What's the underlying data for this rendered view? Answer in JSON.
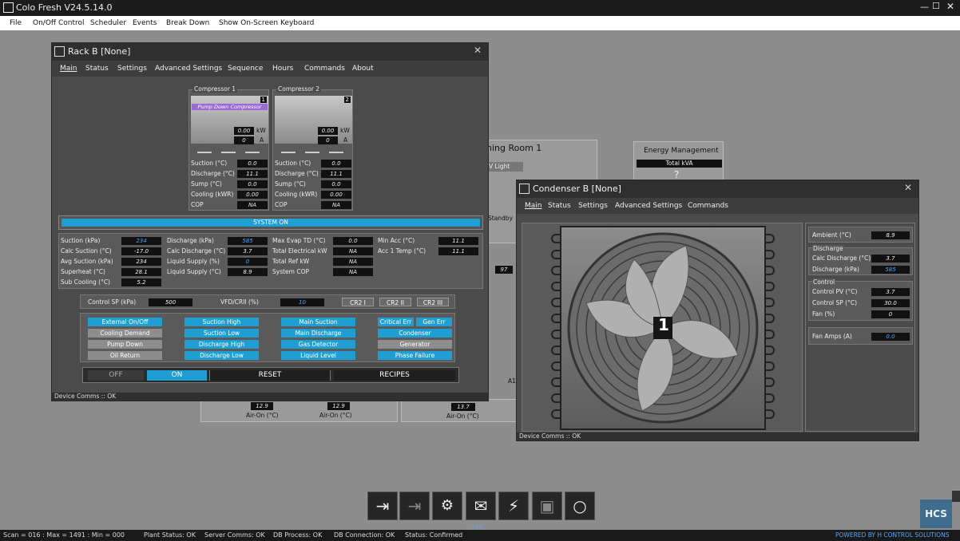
{
  "app": {
    "title": "Colo Fresh V24.5.14.0"
  },
  "menu": [
    "File",
    "On/Off Control",
    "Scheduler",
    "Events",
    "Break Down",
    "Show On-Screen Keyboard"
  ],
  "background": {
    "room_title": "ning Room 1",
    "light_label": "V Light",
    "energy_title": "Energy Management",
    "total_kva": "Total kVA",
    "kva_value": "?",
    "standby": "Standby",
    "airon1_val": "12.9",
    "airon2_val": "12.9",
    "airon3_val": "13.7",
    "airon_label": "Air-On (°C)",
    "bg_val": "97",
    "bg_a": "A1"
  },
  "rack": {
    "title": "Rack B [None]",
    "tabs": [
      "Main",
      "Status",
      "Settings",
      "Advanced Settings",
      "Sequence",
      "Hours",
      "Commands",
      "About"
    ],
    "comp1": {
      "title": "Compressor 1",
      "num": "1",
      "banner": "Pump Down Compressor",
      "kw": "0.00",
      "kw_unit": "kW",
      "amps": "0",
      "amps_unit": "A"
    },
    "comp2": {
      "title": "Compressor 2",
      "num": "2",
      "kw": "0.00",
      "kw_unit": "kW",
      "amps": "0",
      "amps_unit": "A"
    },
    "comp_rows": [
      {
        "label": "Suction (°C)",
        "c1": "0.0",
        "c2": "0.0"
      },
      {
        "label": "Discharge (°C)",
        "c1": "11.1",
        "c2": "11.1"
      },
      {
        "label": "Sump (°C)",
        "c1": "0.0",
        "c2": "0.0"
      },
      {
        "label": "Cooling (kWR)",
        "c1": "0.00",
        "c2": "0.00"
      },
      {
        "label": "COP",
        "c1": "NA",
        "c2": "NA"
      }
    ],
    "system_on": "SYSTEM ON",
    "grid_col1": [
      {
        "label": "Suction (kPa)",
        "value": "234"
      },
      {
        "label": "Calc Suction (°C)",
        "value": "-17.0"
      },
      {
        "label": "Avg Suction (kPa)",
        "value": "234"
      },
      {
        "label": "Superheat (°C)",
        "value": "28.1"
      },
      {
        "label": "Sub Cooling (°C)",
        "value": "5.2"
      }
    ],
    "grid_col2": [
      {
        "label": "Discharge (kPa)",
        "value": "585"
      },
      {
        "label": "Calc Discharge (°C)",
        "value": "3.7"
      },
      {
        "label": "Liquid Supply (%)",
        "value": "0"
      },
      {
        "label": "Liquid Supply (°C)",
        "value": "8.9"
      }
    ],
    "grid_col3": [
      {
        "label": "Max Evap TD (°C)",
        "value": "0.0"
      },
      {
        "label": "Total Electrical kW",
        "value": "NA"
      },
      {
        "label": "Total Ref kW",
        "value": "NA"
      },
      {
        "label": "System COP",
        "value": "NA"
      }
    ],
    "grid_col4": [
      {
        "label": "Min Acc (°C)",
        "value": "11.1"
      },
      {
        "label": "Acc 1 Temp (°C)",
        "value": "11.1"
      }
    ],
    "control_sp_label": "Control SP (kPa)",
    "control_sp": "500",
    "vfd_label": "VFD/CRII (%)",
    "vfd": "10",
    "cr_buttons": [
      "CR2 I",
      "CR2 II",
      "CR2 III"
    ],
    "alarms": [
      [
        "External On/Off",
        "Suction High",
        "Main Suction",
        "Critical Err",
        "Gen Err"
      ],
      [
        "Cooling Demand",
        "Suction Low",
        "Main Discharge",
        "Condenser"
      ],
      [
        "Pump Down",
        "Discharge High",
        "Gas Detector",
        "Generator"
      ],
      [
        "Oil Return",
        "Discharge Low",
        "Liquid Level",
        "Phase Failure"
      ]
    ],
    "off": "OFF",
    "on": "ON",
    "reset": "RESET",
    "recipes": "RECIPES",
    "status": "Device Comms :: OK"
  },
  "condenser": {
    "title": "Condenser B [None]",
    "tabs": [
      "Main",
      "Status",
      "Settings",
      "Advanced Settings",
      "Commands"
    ],
    "fan_number": "1",
    "ambient_label": "Ambient (°C)",
    "ambient": "8.9",
    "discharge_group": "Discharge",
    "calc_discharge_label": "Calc Discharge (°C)",
    "calc_discharge": "3.7",
    "discharge_kpa_label": "Discharge (kPa)",
    "discharge_kpa": "585",
    "control_group": "Control",
    "control_pv_label": "Control PV (°C)",
    "control_pv": "3.7",
    "control_sp_label": "Control SP (°C)",
    "control_sp": "30.0",
    "fan_label": "Fan (%)",
    "fan": "0",
    "fan_amps_label": "Fan Amps (A)",
    "fan_amps": "0.0",
    "status": "Device Comms :: OK"
  },
  "toolbar": [
    "login-icon",
    "logout-icon",
    "user-settings-icon",
    "mail-icon",
    "power-icon",
    "save-icon",
    "refresh-icon"
  ],
  "logo": "HCS",
  "statusbar": {
    "scan": "Scan = 016 : Max = 1491 : Min = 000",
    "plant": "Plant Status: OK",
    "server": "Server Comms: OK",
    "db_process": "DB Process:  OK",
    "db_conn": "DB Connection:  OK",
    "status": "Status:  Confirmed",
    "powered": "POWERED BY H CONTROL SOLUTIONS"
  }
}
